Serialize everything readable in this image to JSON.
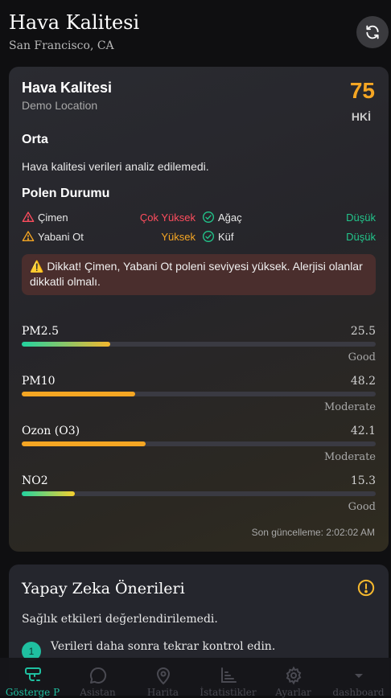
{
  "header": {
    "title": "Hava Kalitesi",
    "location": "San Francisco, CA"
  },
  "card": {
    "title": "Hava Kalitesi",
    "subtitle": "Demo Location",
    "aqi_value": "75",
    "aqi_unit": "HKİ",
    "level": "Orta",
    "analysis": "Hava kalitesi verileri analiz edilemedi.",
    "pollen_title": "Polen Durumu",
    "pollen": [
      {
        "name": "Çimen",
        "value": "Çok Yüksek",
        "color": "#ff4d5e",
        "icon": "warning-icon"
      },
      {
        "name": "Ağaç",
        "value": "Düşük",
        "color": "#22c58b",
        "icon": "check-circle-icon"
      },
      {
        "name": "Yabani Ot",
        "value": "Yüksek",
        "color": "#f5a623",
        "icon": "warning-icon"
      },
      {
        "name": "Küf",
        "value": "Düşük",
        "color": "#22c58b",
        "icon": "check-circle-icon"
      }
    ],
    "warning": "⚠️ Dikkat! Çimen, Yabani Ot poleni seviyesi yüksek. Alerjisi olanlar dikkatli olmalı.",
    "pollutants": [
      {
        "name": "PM2.5",
        "value": "25.5",
        "status": "Good",
        "fill": 0.25,
        "colors": [
          "#22d3a0",
          "#f5b82e"
        ]
      },
      {
        "name": "PM10",
        "value": "48.2",
        "status": "Moderate",
        "fill": 0.32,
        "colors": [
          "#f5a623",
          "#f5a623"
        ]
      },
      {
        "name": "Ozon (O3)",
        "value": "42.1",
        "status": "Moderate",
        "fill": 0.35,
        "colors": [
          "#f5a623",
          "#f5a623"
        ]
      },
      {
        "name": "NO2",
        "value": "15.3",
        "status": "Good",
        "fill": 0.15,
        "colors": [
          "#22d3a0",
          "#f5d02e"
        ]
      }
    ],
    "updated": "Son güncelleme: 2:02:02 AM"
  },
  "ai": {
    "title": "Yapay Zeka Önerileri",
    "text": "Sağlık etkileri değerlendirilemedi.",
    "step_number": "1",
    "step_text": "Verileri daha sonra tekrar kontrol edin."
  },
  "nav": [
    {
      "label": "Gösterge P",
      "icon": "dashboard-icon",
      "active": true
    },
    {
      "label": "Asistan",
      "icon": "chat-icon",
      "active": false
    },
    {
      "label": "Harita",
      "icon": "map-pin-icon",
      "active": false
    },
    {
      "label": "İstatistikler",
      "icon": "stats-icon",
      "active": false
    },
    {
      "label": "Ayarlar",
      "icon": "gear-icon",
      "active": false
    },
    {
      "label": "dashboard",
      "icon": "chevron-down-icon",
      "active": false
    }
  ],
  "colors": {
    "accent": "#1fbfa0",
    "aqi": "#f5a623"
  }
}
